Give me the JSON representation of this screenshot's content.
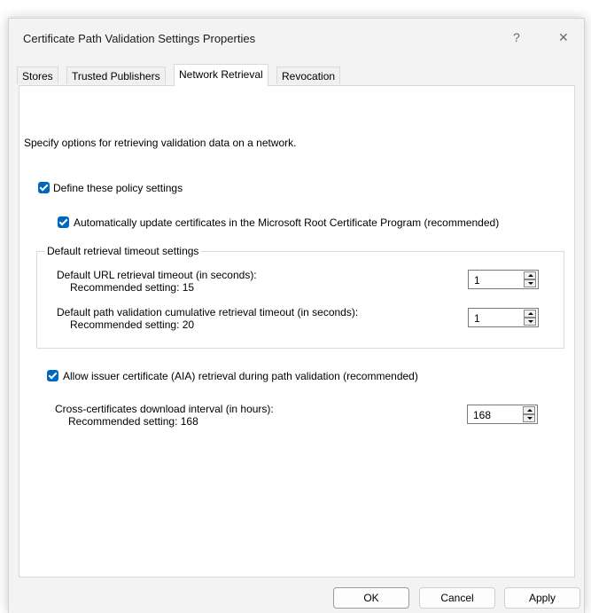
{
  "window": {
    "title": "Certificate Path Validation Settings Properties",
    "help_glyph": "?",
    "close_glyph": "✕"
  },
  "tabs": [
    {
      "label": "Stores"
    },
    {
      "label": "Trusted Publishers"
    },
    {
      "label": "Network Retrieval",
      "active": true
    },
    {
      "label": "Revocation"
    }
  ],
  "panel": {
    "intro": "Specify options for retrieving validation data on a network.",
    "define_policy": {
      "label": "Define these policy settings",
      "checked": true
    },
    "auto_update": {
      "label": "Automatically update certificates in the Microsoft Root Certificate Program (recommended)",
      "checked": true
    },
    "timeout_group": {
      "label": "Default retrieval timeout settings",
      "url_timeout": {
        "label": "Default URL retrieval timeout (in seconds):",
        "recommended": "Recommended setting: 15",
        "value": "1"
      },
      "path_timeout": {
        "label": "Default path validation cumulative retrieval timeout (in seconds):",
        "recommended": "Recommended setting: 20",
        "value": "1"
      }
    },
    "aia": {
      "label": "Allow issuer certificate (AIA) retrieval during path validation (recommended)",
      "checked": true
    },
    "cross_cert": {
      "label": "Cross-certificates download interval (in hours):",
      "recommended": "Recommended setting: 168",
      "value": "168"
    }
  },
  "buttons": {
    "ok": "OK",
    "cancel": "Cancel",
    "apply": "Apply"
  },
  "colors": {
    "accent": "#0067c0",
    "window_bg": "#f3f3f3"
  }
}
